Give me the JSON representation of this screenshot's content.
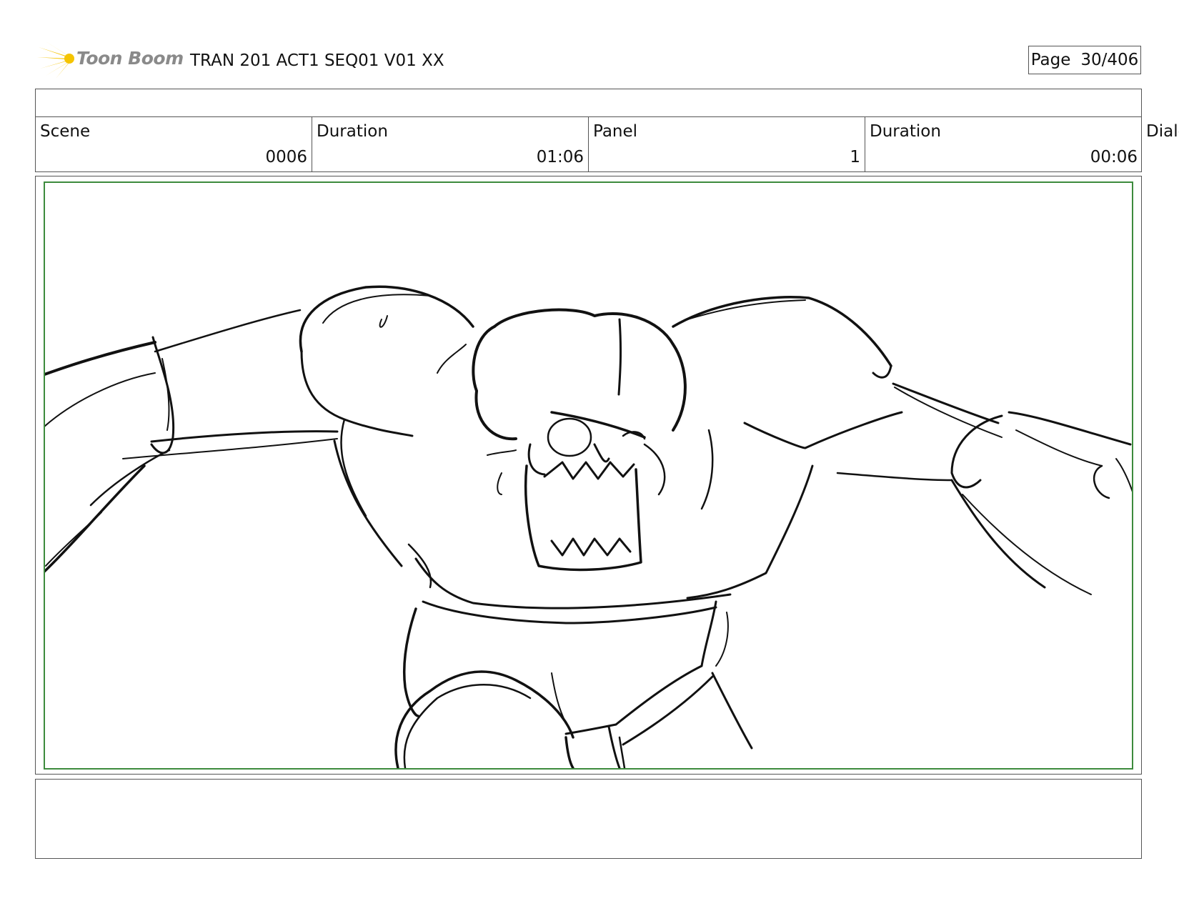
{
  "header": {
    "logo_text": "Toon Boom",
    "logo_icon": "sunburst-logo-icon",
    "title": "TRAN 201 ACT1 SEQ01 V01 XX",
    "page_label": "Page",
    "page_value": "30/406"
  },
  "info": {
    "scene_label": "Scene",
    "scene_value": "0006",
    "scene_duration_label": "Duration",
    "scene_duration_value": "01:06",
    "panel_label": "Panel",
    "panel_value": "1",
    "panel_duration_label": "Duration",
    "panel_duration_value": "00:06",
    "dialogue_label": "Dialo"
  },
  "colors": {
    "safe_frame": "#3d8b3d",
    "logo_yellow": "#f5c400",
    "logo_text": "#8a8a8a"
  },
  "panel": {
    "image_subject": "rough sketch of a hulking muscular skull-faced creature with arms spread wide"
  }
}
